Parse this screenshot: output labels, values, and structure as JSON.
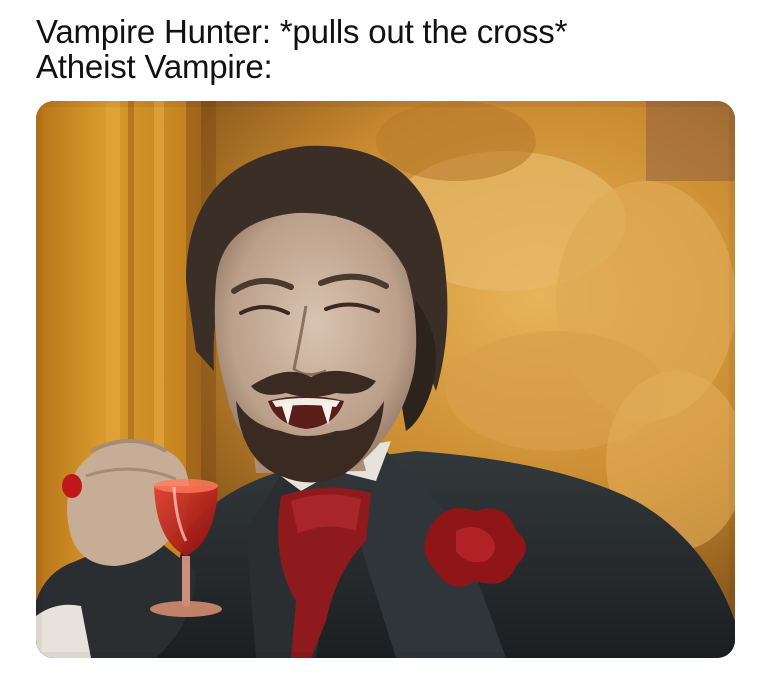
{
  "caption": {
    "line1": "Vampire Hunter: *pulls out the cross*",
    "line2": "Atheist Vampire:"
  },
  "image": {
    "icon": "laughing-vampire-toast-photo",
    "colors": {
      "background_gold": "#c98b24",
      "wall_orange": "#d3901f",
      "suit_dark": "#262a2c",
      "cravat_red": "#8e1a1e",
      "wine_red": "#c0181a",
      "skin": "#c7ae99",
      "hair": "#3a2e27"
    }
  }
}
